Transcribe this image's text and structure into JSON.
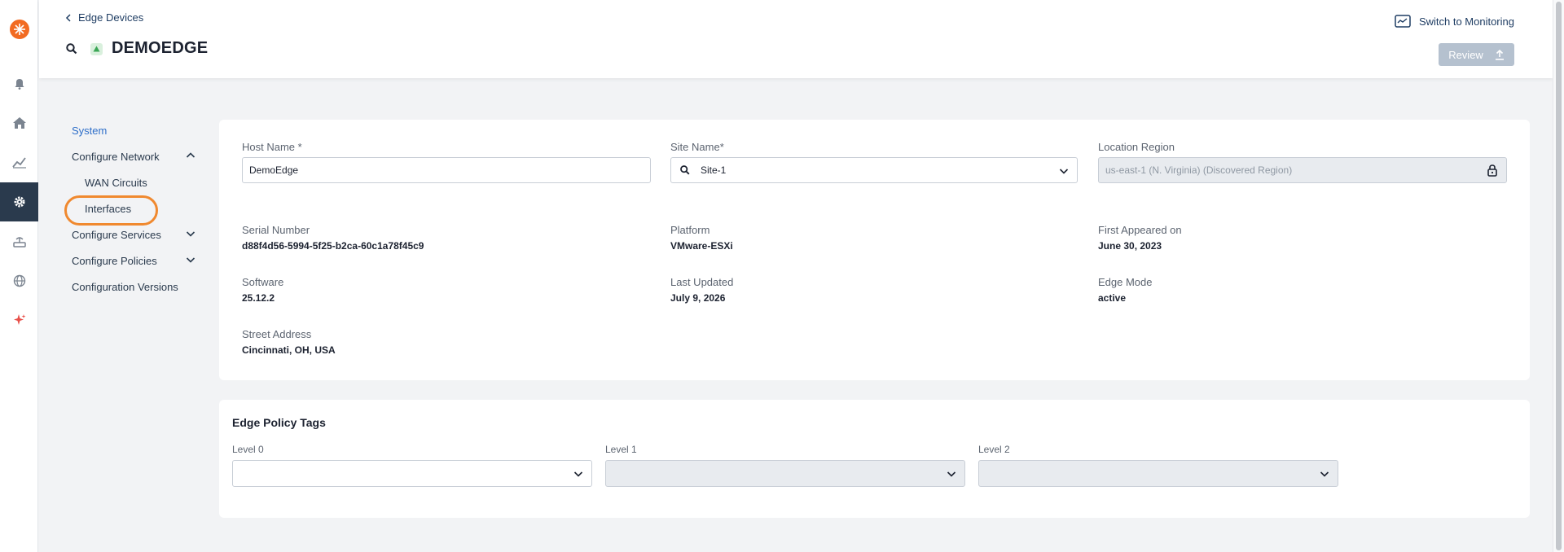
{
  "rail": {
    "items": [
      {
        "name": "bell-icon"
      },
      {
        "name": "home-icon"
      },
      {
        "name": "chart-line-icon"
      },
      {
        "name": "gear-icon"
      },
      {
        "name": "router-icon"
      },
      {
        "name": "globe-network-icon"
      },
      {
        "name": "sparkle-icon"
      }
    ]
  },
  "header": {
    "breadcrumb": "Edge Devices",
    "title": "DEMOEDGE",
    "switch_label": "Switch to Monitoring",
    "review_label": "Review"
  },
  "subnav": {
    "system": "System",
    "configure_network": "Configure Network",
    "wan_circuits": "WAN Circuits",
    "interfaces": "Interfaces",
    "configure_services": "Configure Services",
    "configure_policies": "Configure Policies",
    "configuration_versions": "Configuration Versions"
  },
  "system_card": {
    "host_name_label": "Host Name *",
    "host_name_value": "DemoEdge",
    "site_name_label": "Site Name*",
    "site_name_value": "Site-1",
    "location_region_label": "Location Region",
    "location_region_value": "us-east-1 (N. Virginia) (Discovered Region)",
    "serial_label": "Serial Number",
    "serial_value": "d88f4d56-5994-5f25-b2ca-60c1a78f45c9",
    "platform_label": "Platform",
    "platform_value": "VMware-ESXi",
    "first_appeared_label": "First Appeared on",
    "first_appeared_value": "June 30, 2023",
    "software_label": "Software",
    "software_value": "25.12.2",
    "last_updated_label": "Last Updated",
    "last_updated_value": "July 9, 2026",
    "edge_mode_label": "Edge Mode",
    "edge_mode_value": "active",
    "street_label": "Street Address",
    "street_value": "Cincinnati, OH, USA"
  },
  "policy_card": {
    "title": "Edge Policy Tags",
    "level0_label": "Level 0",
    "level1_label": "Level 1",
    "level2_label": "Level 2"
  },
  "colors": {
    "brand": "#f26b22",
    "active_rail": "#2a3a4d",
    "link": "#2f6fc9",
    "highlight": "#f0892f"
  }
}
